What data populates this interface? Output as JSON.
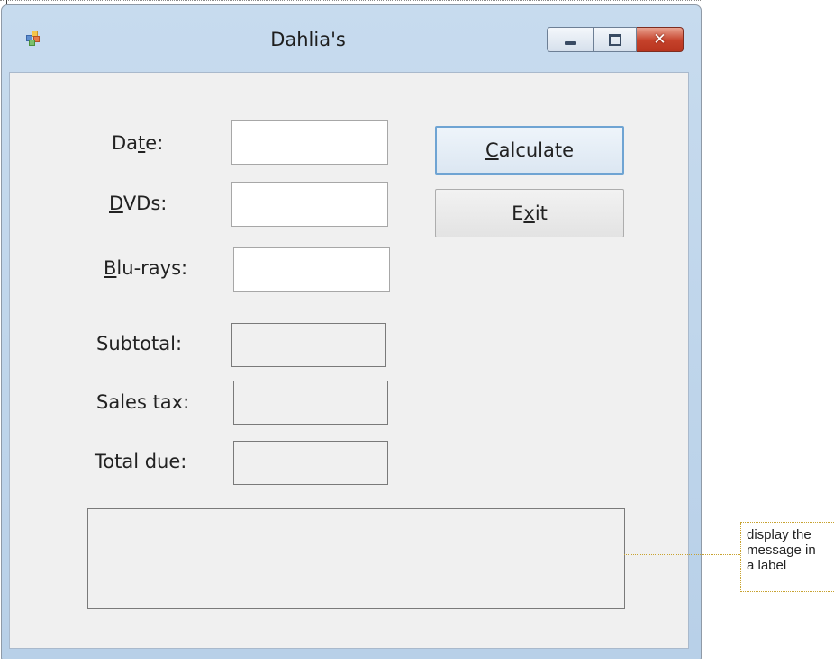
{
  "window": {
    "title": "Dahlia's",
    "controls": {
      "minimize": "minimize",
      "maximize": "maximize",
      "close": "✕"
    }
  },
  "form": {
    "date": {
      "label_pre": "Da",
      "label_mnemonic": "t",
      "label_post": "e:",
      "value": ""
    },
    "dvds": {
      "label_pre": "",
      "label_mnemonic": "D",
      "label_post": "VDs:",
      "value": ""
    },
    "blurays": {
      "label_pre": "",
      "label_mnemonic": "B",
      "label_post": "lu-rays:",
      "value": ""
    },
    "subtotal": {
      "label": "Subtotal:",
      "value": ""
    },
    "sales_tax": {
      "label": "Sales tax:",
      "value": ""
    },
    "total_due": {
      "label": "Total due:",
      "value": ""
    },
    "message": {
      "value": ""
    }
  },
  "buttons": {
    "calculate": {
      "label_mnemonic": "C",
      "label_post": "alculate"
    },
    "exit": {
      "label_pre": "E",
      "label_mnemonic": "x",
      "label_post": "it"
    }
  },
  "callout": {
    "text": "display the\nmessage in\na label"
  },
  "icons": {
    "app": "app-icon",
    "minimize": "minimize-icon",
    "maximize": "maximize-icon",
    "close": "close-icon"
  },
  "colors": {
    "client_bg": "#f0f0f0",
    "frame": "#b8d0e8",
    "close_button": "#c5412a",
    "callout_border": "#c8a331"
  }
}
